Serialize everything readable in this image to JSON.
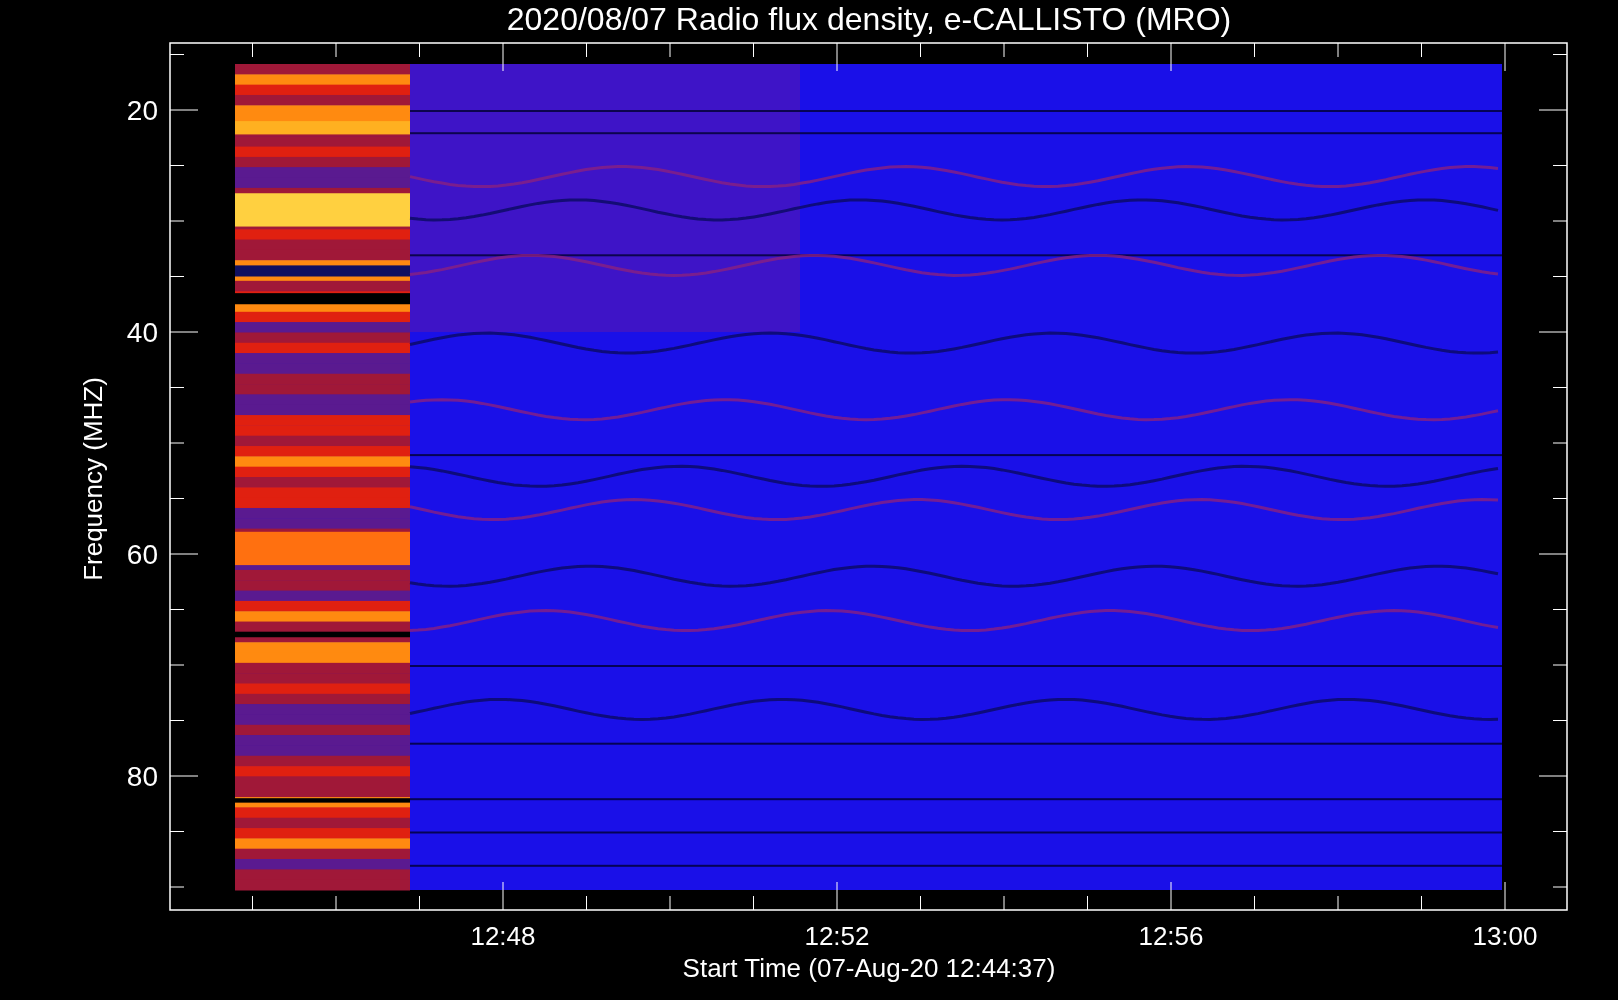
{
  "title": "2020/08/07  Radio flux density, e-CALLISTO (MRO)",
  "y_axis": {
    "label": "Frequency (MHZ)",
    "ticks": [
      "20",
      "40",
      "60",
      "80"
    ]
  },
  "x_axis": {
    "label": "Start Time (07-Aug-20 12:44:37)",
    "ticks": [
      "12:48",
      "12:52",
      "12:56",
      "13:00"
    ]
  }
}
